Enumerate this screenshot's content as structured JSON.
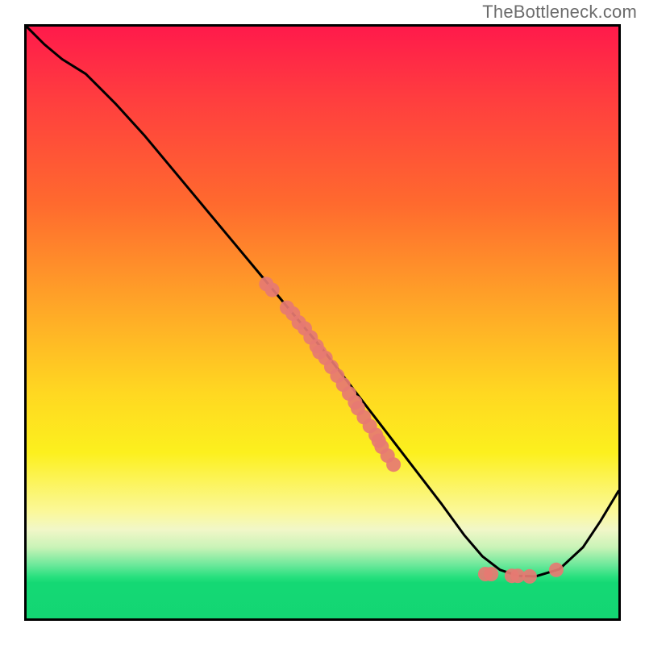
{
  "watermark": "TheBottleneck.com",
  "chart_data": {
    "type": "line",
    "title": "",
    "xlabel": "",
    "ylabel": "",
    "xlim": [
      0,
      100
    ],
    "ylim": [
      0,
      100
    ],
    "grid": false,
    "legend": false,
    "series": [
      {
        "name": "curve",
        "color": "#000000",
        "x": [
          0,
          3,
          6,
          10,
          15,
          20,
          25,
          30,
          35,
          40,
          45,
          50,
          55,
          60,
          65,
          70,
          74,
          77,
          80,
          83,
          86,
          90,
          94,
          97,
          100
        ],
        "y": [
          100,
          97,
          94.5,
          92,
          87,
          81.5,
          75.5,
          69.5,
          63.5,
          57.5,
          51.5,
          45.5,
          39,
          32.5,
          26,
          19.5,
          14,
          10.5,
          8.2,
          7.2,
          7.1,
          8.3,
          12,
          16.5,
          21.5
        ]
      }
    ],
    "scatter_points": {
      "name": "markers",
      "color": "#e67a72",
      "radius_px": 9,
      "points": [
        {
          "x": 40.5,
          "y": 56.5
        },
        {
          "x": 41.5,
          "y": 55.5
        },
        {
          "x": 44.0,
          "y": 52.5
        },
        {
          "x": 45.0,
          "y": 51.5
        },
        {
          "x": 46.0,
          "y": 50.0
        },
        {
          "x": 47.0,
          "y": 49.0
        },
        {
          "x": 48.0,
          "y": 47.5
        },
        {
          "x": 49.0,
          "y": 46.0
        },
        {
          "x": 49.5,
          "y": 45.0
        },
        {
          "x": 50.5,
          "y": 44.0
        },
        {
          "x": 51.5,
          "y": 42.5
        },
        {
          "x": 52.5,
          "y": 41.0
        },
        {
          "x": 53.5,
          "y": 39.5
        },
        {
          "x": 54.5,
          "y": 38.0
        },
        {
          "x": 55.5,
          "y": 36.5
        },
        {
          "x": 56.0,
          "y": 35.5
        },
        {
          "x": 57.0,
          "y": 34.0
        },
        {
          "x": 58.0,
          "y": 32.5
        },
        {
          "x": 59.0,
          "y": 31.0
        },
        {
          "x": 59.5,
          "y": 30.0
        },
        {
          "x": 60.0,
          "y": 29.0
        },
        {
          "x": 61.0,
          "y": 27.5
        },
        {
          "x": 62.0,
          "y": 26.0
        },
        {
          "x": 77.5,
          "y": 7.5
        },
        {
          "x": 78.5,
          "y": 7.5
        },
        {
          "x": 82.0,
          "y": 7.2
        },
        {
          "x": 83.0,
          "y": 7.2
        },
        {
          "x": 85.0,
          "y": 7.1
        },
        {
          "x": 89.5,
          "y": 8.2
        }
      ]
    },
    "gradient_stops": [
      {
        "pct": 0,
        "color": "#ff1a4b"
      },
      {
        "pct": 12,
        "color": "#ff3d3f"
      },
      {
        "pct": 30,
        "color": "#ff6a2e"
      },
      {
        "pct": 48,
        "color": "#ffa927"
      },
      {
        "pct": 62,
        "color": "#ffd821"
      },
      {
        "pct": 72,
        "color": "#fcf01e"
      },
      {
        "pct": 82,
        "color": "#fbf89a"
      },
      {
        "pct": 85,
        "color": "#f1f7c8"
      },
      {
        "pct": 88,
        "color": "#c9f3b7"
      },
      {
        "pct": 91,
        "color": "#6be89a"
      },
      {
        "pct": 93,
        "color": "#27e07e"
      },
      {
        "pct": 94,
        "color": "#14d874"
      },
      {
        "pct": 100,
        "color": "#13d673"
      }
    ]
  }
}
